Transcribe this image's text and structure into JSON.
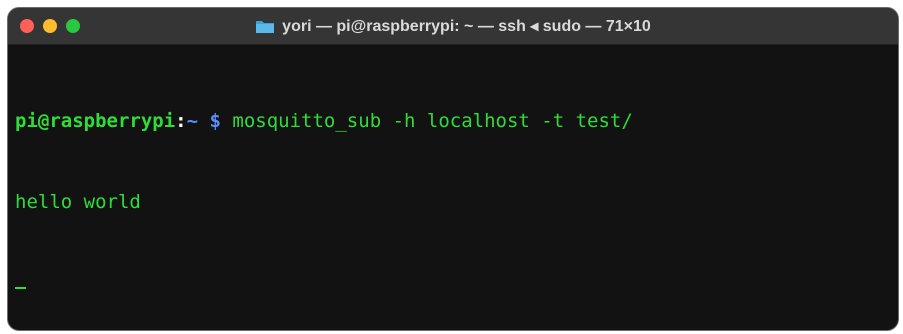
{
  "window": {
    "title": "yori — pi@raspberrypi: ~ — ssh ◂ sudo — 71×10",
    "colors": {
      "background": "#121212",
      "titlebar": "#353535",
      "text": "#2fdc38",
      "path": "#5a8cff"
    }
  },
  "terminal": {
    "prompt_user_host": "pi@raspberrypi",
    "prompt_separator": ":",
    "prompt_path": "~",
    "prompt_symbol": "$",
    "command": "mosquitto_sub -h localhost -t test/",
    "output": [
      "hello world"
    ]
  }
}
